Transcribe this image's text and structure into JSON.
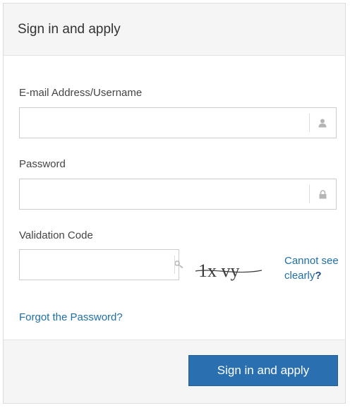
{
  "header": {
    "title": "Sign in and apply"
  },
  "form": {
    "username": {
      "label": "E-mail Address/Username",
      "value": "",
      "placeholder": ""
    },
    "password": {
      "label": "Password",
      "value": "",
      "placeholder": ""
    },
    "validation": {
      "label": "Validation Code",
      "value": "",
      "placeholder": "",
      "captcha_text": "1x vy",
      "cannot_see_text": "Cannot see clearly",
      "cannot_see_q": "?"
    },
    "forgot_link": "Forgot the Password?"
  },
  "footer": {
    "submit_label": "Sign in and apply"
  },
  "colors": {
    "accent": "#2a6fb0",
    "link": "#1e6fa8",
    "header_bg": "#f5f5f5"
  },
  "icons": {
    "username": "user-icon",
    "password": "lock-icon",
    "validation": "key-icon"
  }
}
